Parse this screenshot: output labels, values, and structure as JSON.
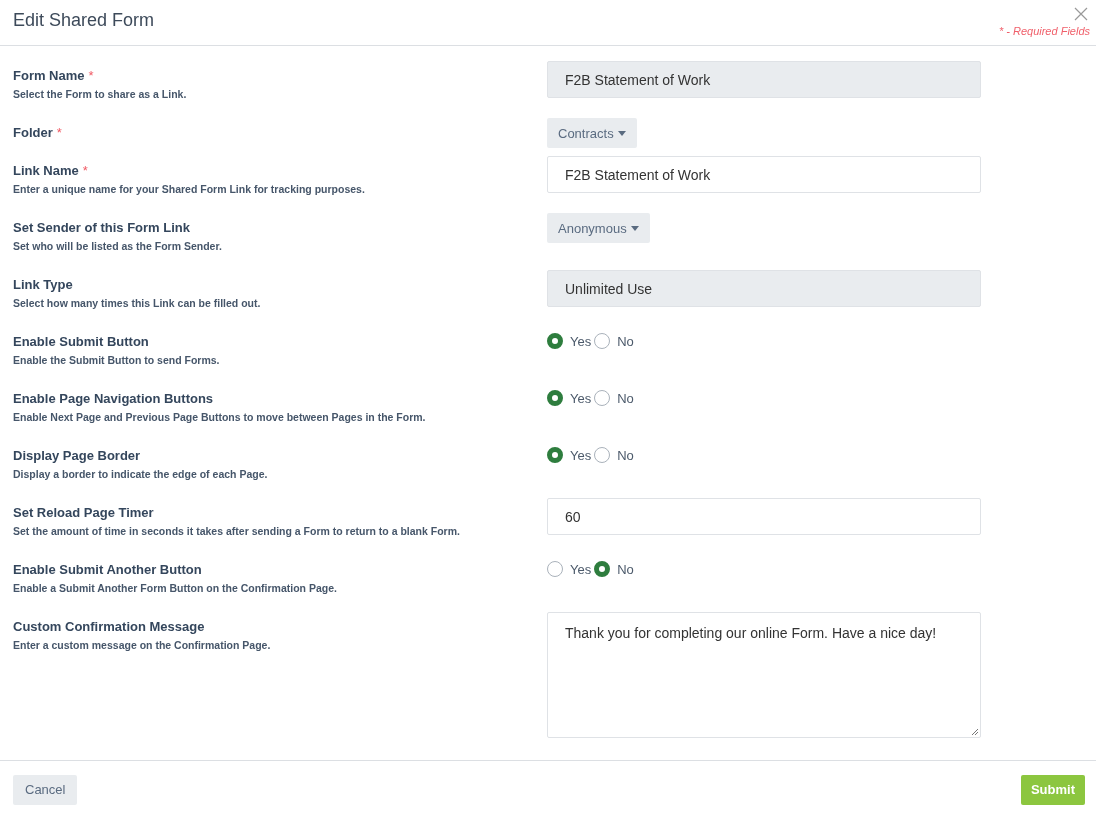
{
  "window": {
    "title": "Edit Shared Form",
    "required_note": "* - Required Fields"
  },
  "fields": [
    {
      "kind": "readonly",
      "label": "Form Name",
      "required_mark": "*",
      "description": "Select the Form to share as a Link.",
      "value": "F2B Statement of Work"
    },
    {
      "kind": "dropdown",
      "label": "Folder",
      "required_mark": "*",
      "value": "Contracts"
    },
    {
      "kind": "input",
      "label": "Link Name",
      "required_mark": "*",
      "description": "Enter a unique name for your Shared Form Link for tracking purposes.",
      "value": "F2B Statement of Work"
    },
    {
      "kind": "dropdown",
      "label": "Set Sender of this Form Link",
      "description": "Set who will be listed as the Form Sender.",
      "value": "Anonymous"
    },
    {
      "kind": "readonly",
      "label": "Link Type",
      "description": "Select how many times this Link can be filled out.",
      "value": "Unlimited Use"
    },
    {
      "kind": "radio",
      "label": "Enable Submit Button",
      "description": "Enable the Submit Button to send Forms.",
      "options": [
        {
          "label": "Yes",
          "selected": true
        },
        {
          "label": "No",
          "selected": false
        }
      ]
    },
    {
      "kind": "radio",
      "label": "Enable Page Navigation Buttons",
      "description": "Enable Next Page and Previous Page Buttons to move between Pages in the Form.",
      "options": [
        {
          "label": "Yes",
          "selected": true
        },
        {
          "label": "No",
          "selected": false
        }
      ]
    },
    {
      "kind": "radio",
      "label": "Display Page Border",
      "description": "Display a border to indicate the edge of each Page.",
      "options": [
        {
          "label": "Yes",
          "selected": true
        },
        {
          "label": "No",
          "selected": false
        }
      ]
    },
    {
      "kind": "input",
      "label": "Set Reload Page Timer",
      "description": "Set the amount of time in seconds it takes after sending a Form to return to a blank Form.",
      "value": "60"
    },
    {
      "kind": "radio",
      "label": "Enable Submit Another Button",
      "description": "Enable a Submit Another Form Button on the Confirmation Page.",
      "options": [
        {
          "label": "Yes",
          "selected": false
        },
        {
          "label": "No",
          "selected": true
        }
      ]
    },
    {
      "kind": "textarea",
      "label": "Custom Confirmation Message",
      "description": "Enter a custom message on the Confirmation Page.",
      "value": "Thank you for completing our online Form. Have a nice day!"
    }
  ],
  "buttons": {
    "cancel": "Cancel",
    "submit": "Submit"
  }
}
